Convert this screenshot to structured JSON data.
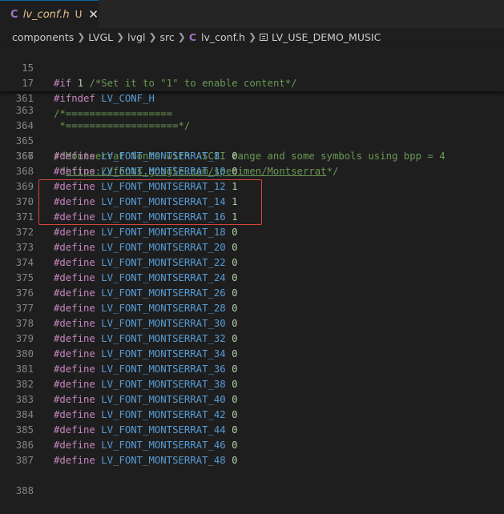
{
  "tab": {
    "icon": "C",
    "filename": "lv_conf.h",
    "status": "U",
    "close": "✕"
  },
  "breadcrumb": {
    "items": [
      "components",
      "LVGL",
      "lvgl",
      "src"
    ],
    "file_icon": "C",
    "file": "lv_conf.h",
    "symbol": "LV_USE_DEMO_MUSIC"
  },
  "sticky_lines": [
    {
      "num": "15",
      "kw": "#if",
      "rest": " ",
      "n": "1",
      "comment": " /*Set it to \"1\" to enable content*/"
    },
    {
      "num": "17",
      "kw": "#ifndef",
      "macro": " LV_CONF_H"
    },
    {
      "num": "361",
      "comment": "/*=================="
    }
  ],
  "partial_line": {
    "num": "363",
    "comment": " *===================*/"
  },
  "blank_line": {
    "num": "364"
  },
  "comment_line_1": {
    "num": "365",
    "comment": "/*Montserrat fonts with ASCII range and some symbols using bpp = 4"
  },
  "comment_line_2": {
    "num": "366",
    "prefix": " *",
    "link": "https://fonts.google.com/specimen/Montserrat",
    "suffix": "*/"
  },
  "define_lines": [
    {
      "num": "367",
      "kw": "#define",
      "macro": " LV_FONT_MONTSERRAT_8",
      "pad": "  ",
      "value": "0"
    },
    {
      "num": "368",
      "kw": "#define",
      "macro": " LV_FONT_MONTSERRAT_10",
      "pad": " ",
      "value": "0"
    },
    {
      "num": "369",
      "kw": "#define",
      "macro": " LV_FONT_MONTSERRAT_12",
      "pad": " ",
      "value": "1"
    },
    {
      "num": "370",
      "kw": "#define",
      "macro": " LV_FONT_MONTSERRAT_14",
      "pad": " ",
      "value": "1"
    },
    {
      "num": "371",
      "kw": "#define",
      "macro": " LV_FONT_MONTSERRAT_16",
      "pad": " ",
      "value": "1"
    },
    {
      "num": "372",
      "kw": "#define",
      "macro": " LV_FONT_MONTSERRAT_18",
      "pad": " ",
      "value": "0"
    },
    {
      "num": "373",
      "kw": "#define",
      "macro": " LV_FONT_MONTSERRAT_20",
      "pad": " ",
      "value": "0"
    },
    {
      "num": "374",
      "kw": "#define",
      "macro": " LV_FONT_MONTSERRAT_22",
      "pad": " ",
      "value": "0"
    },
    {
      "num": "375",
      "kw": "#define",
      "macro": " LV_FONT_MONTSERRAT_24",
      "pad": " ",
      "value": "0"
    },
    {
      "num": "376",
      "kw": "#define",
      "macro": " LV_FONT_MONTSERRAT_26",
      "pad": " ",
      "value": "0"
    },
    {
      "num": "377",
      "kw": "#define",
      "macro": " LV_FONT_MONTSERRAT_28",
      "pad": " ",
      "value": "0"
    },
    {
      "num": "378",
      "kw": "#define",
      "macro": " LV_FONT_MONTSERRAT_30",
      "pad": " ",
      "value": "0"
    },
    {
      "num": "379",
      "kw": "#define",
      "macro": " LV_FONT_MONTSERRAT_32",
      "pad": " ",
      "value": "0"
    },
    {
      "num": "380",
      "kw": "#define",
      "macro": " LV_FONT_MONTSERRAT_34",
      "pad": " ",
      "value": "0"
    },
    {
      "num": "381",
      "kw": "#define",
      "macro": " LV_FONT_MONTSERRAT_36",
      "pad": " ",
      "value": "0"
    },
    {
      "num": "382",
      "kw": "#define",
      "macro": " LV_FONT_MONTSERRAT_38",
      "pad": " ",
      "value": "0"
    },
    {
      "num": "383",
      "kw": "#define",
      "macro": " LV_FONT_MONTSERRAT_40",
      "pad": " ",
      "value": "0"
    },
    {
      "num": "384",
      "kw": "#define",
      "macro": " LV_FONT_MONTSERRAT_42",
      "pad": " ",
      "value": "0"
    },
    {
      "num": "385",
      "kw": "#define",
      "macro": " LV_FONT_MONTSERRAT_44",
      "pad": " ",
      "value": "0"
    },
    {
      "num": "386",
      "kw": "#define",
      "macro": " LV_FONT_MONTSERRAT_46",
      "pad": " ",
      "value": "0"
    },
    {
      "num": "387",
      "kw": "#define",
      "macro": " LV_FONT_MONTSERRAT_48",
      "pad": " ",
      "value": "0"
    }
  ],
  "last_line": {
    "num": "388"
  },
  "colors": {
    "background": "#1e1e1e",
    "tabbar": "#252526",
    "keyword": "#c586c0",
    "macro": "#569cd6",
    "number": "#b5cea8",
    "comment": "#6a9955",
    "line_number": "#858585",
    "highlight_box": "#d6463d"
  }
}
